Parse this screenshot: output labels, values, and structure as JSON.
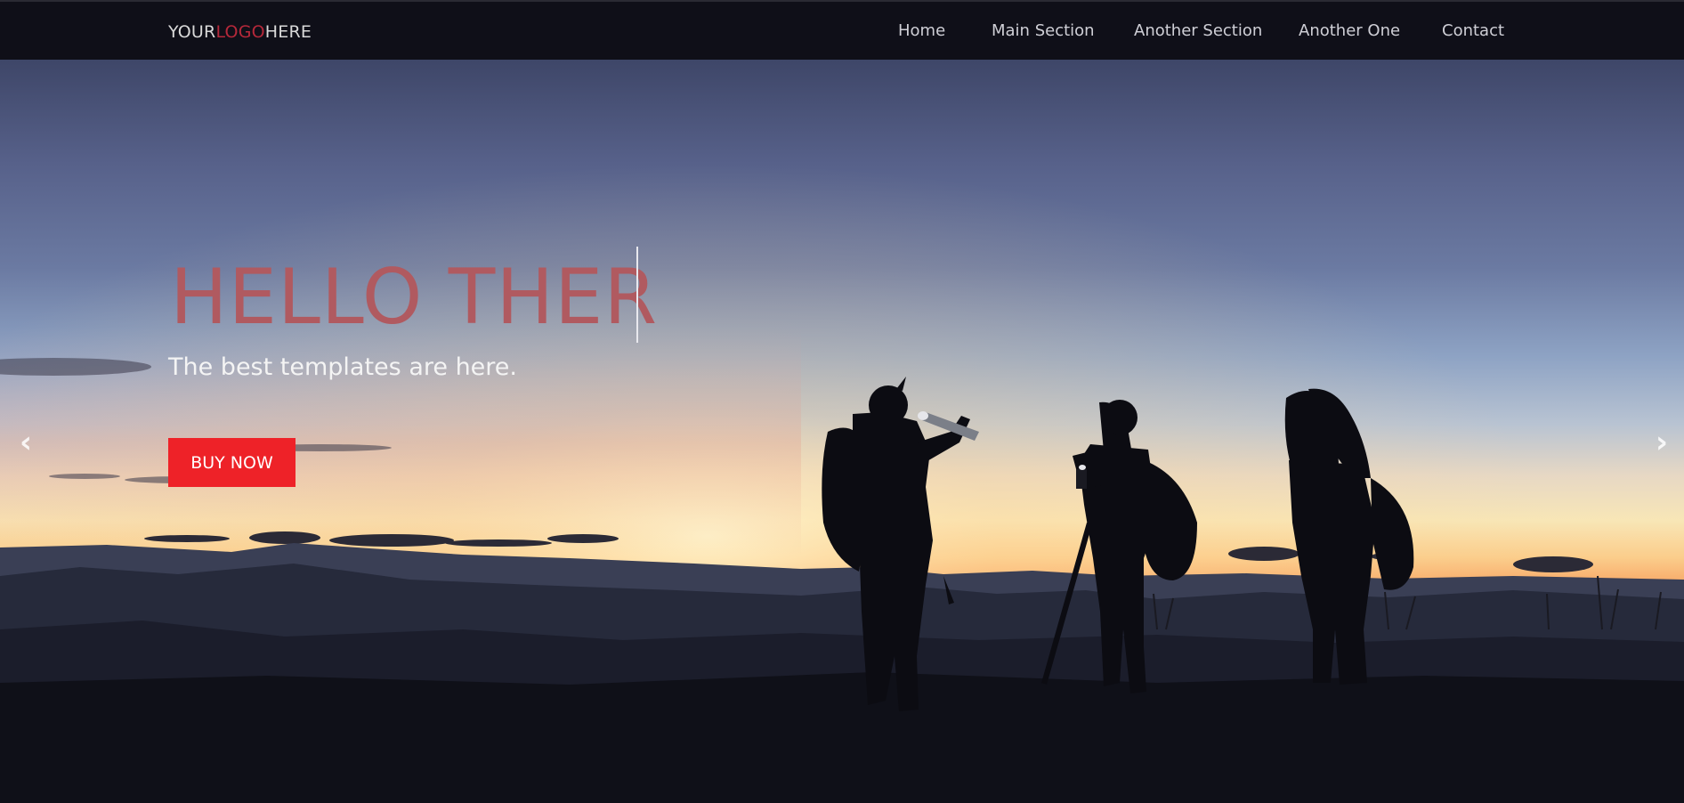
{
  "header": {
    "logo": {
      "part1": "YOUR",
      "part2": "LOGO",
      "part3": "HERE"
    },
    "nav": [
      "Home",
      "Main Section",
      "Another Section",
      "Another One",
      "Contact"
    ]
  },
  "hero": {
    "headline": "HELLO THER",
    "subtitle": "The best templates are here.",
    "button_label": "BUY NOW",
    "prev_icon": "chevron-left-icon",
    "next_icon": "chevron-right-icon",
    "prev_glyph": "‹",
    "next_glyph": "›"
  },
  "colors": {
    "navbar_bg": "#0f0f18",
    "logo_accent": "#b5283a",
    "headline": "#b05a60",
    "button_bg": "#ee2228"
  }
}
